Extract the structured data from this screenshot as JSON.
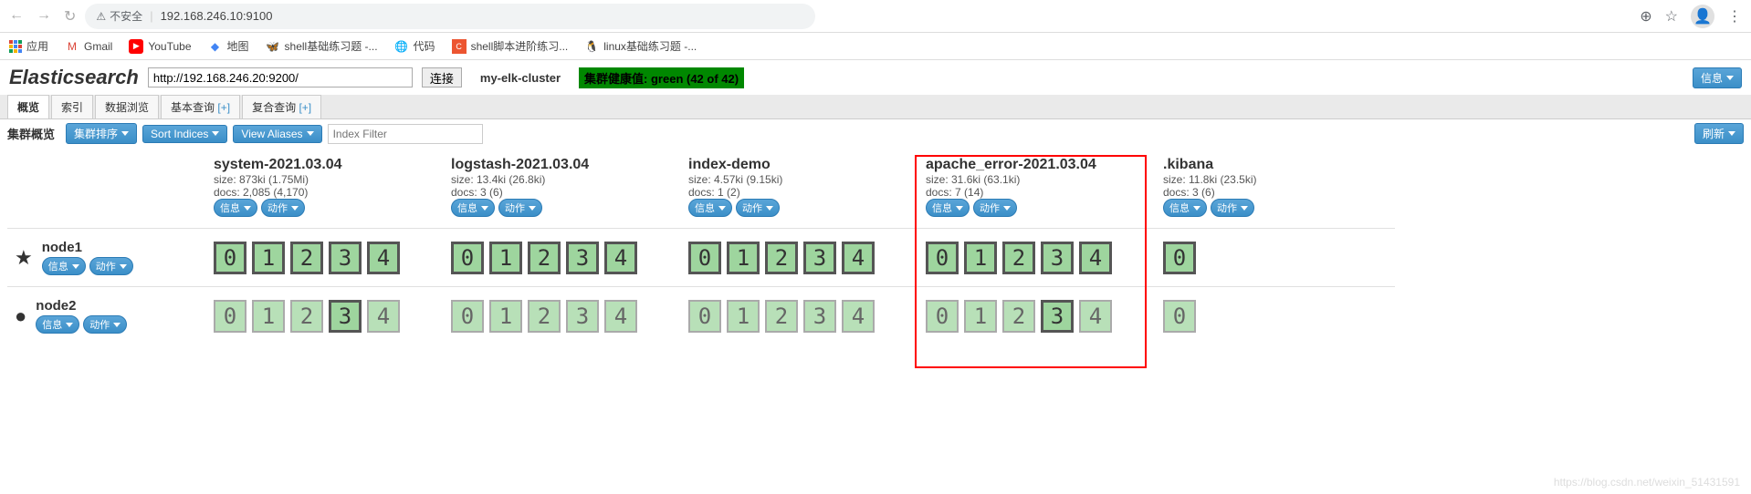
{
  "browser": {
    "insecure_label": "不安全",
    "url": "192.168.246.10:9100"
  },
  "bookmarks": {
    "apps": "应用",
    "gmail": "Gmail",
    "youtube": "YouTube",
    "maps": "地图",
    "shell1": "shell基础练习题 -...",
    "code": "代码",
    "shell2": "shell脚本进阶练习...",
    "linux": "linux基础练习题 -..."
  },
  "header": {
    "title": "Elasticsearch",
    "url_value": "http://192.168.246.20:9200/",
    "connect": "连接",
    "cluster": "my-elk-cluster",
    "health": "集群健康值: green (42 of 42)",
    "info_btn": "信息"
  },
  "tabs": {
    "overview": "概览",
    "indices": "索引",
    "browser": "数据浏览",
    "basic": "基本查询",
    "compound": "复合查询",
    "plus": "[+]"
  },
  "toolbar": {
    "label": "集群概览",
    "sort_cluster": "集群排序",
    "sort_indices": "Sort Indices",
    "view_aliases": "View Aliases",
    "filter_placeholder": "Index Filter",
    "refresh": "刷新"
  },
  "btn": {
    "info": "信息",
    "action": "动作"
  },
  "nodes": [
    {
      "name": "node1",
      "master": true
    },
    {
      "name": "node2",
      "master": false
    }
  ],
  "indices": [
    {
      "name": "system-2021.03.04",
      "size": "size: 873ki (1.75Mi)",
      "docs": "docs: 2,085 (4,170)",
      "shards": 5,
      "highlighted": false,
      "node1_primary": [
        true,
        true,
        true,
        true,
        true
      ],
      "node2_primary": [
        false,
        false,
        false,
        true,
        false
      ]
    },
    {
      "name": "logstash-2021.03.04",
      "size": "size: 13.4ki (26.8ki)",
      "docs": "docs: 3 (6)",
      "shards": 5,
      "highlighted": false,
      "node1_primary": [
        true,
        true,
        true,
        true,
        true
      ],
      "node2_primary": [
        false,
        false,
        false,
        false,
        false
      ]
    },
    {
      "name": "index-demo",
      "size": "size: 4.57ki (9.15ki)",
      "docs": "docs: 1 (2)",
      "shards": 5,
      "highlighted": false,
      "node1_primary": [
        true,
        true,
        true,
        true,
        true
      ],
      "node2_primary": [
        false,
        false,
        false,
        false,
        false
      ]
    },
    {
      "name": "apache_error-2021.03.04",
      "size": "size: 31.6ki (63.1ki)",
      "docs": "docs: 7 (14)",
      "shards": 5,
      "highlighted": true,
      "node1_primary": [
        true,
        true,
        true,
        true,
        true
      ],
      "node2_primary": [
        false,
        false,
        false,
        true,
        false
      ]
    },
    {
      "name": ".kibana",
      "size": "size: 11.8ki (23.5ki)",
      "docs": "docs: 3 (6)",
      "shards": 1,
      "highlighted": false,
      "node1_primary": [
        true
      ],
      "node2_primary": [
        false
      ]
    }
  ],
  "watermark": "https://blog.csdn.net/weixin_51431591"
}
